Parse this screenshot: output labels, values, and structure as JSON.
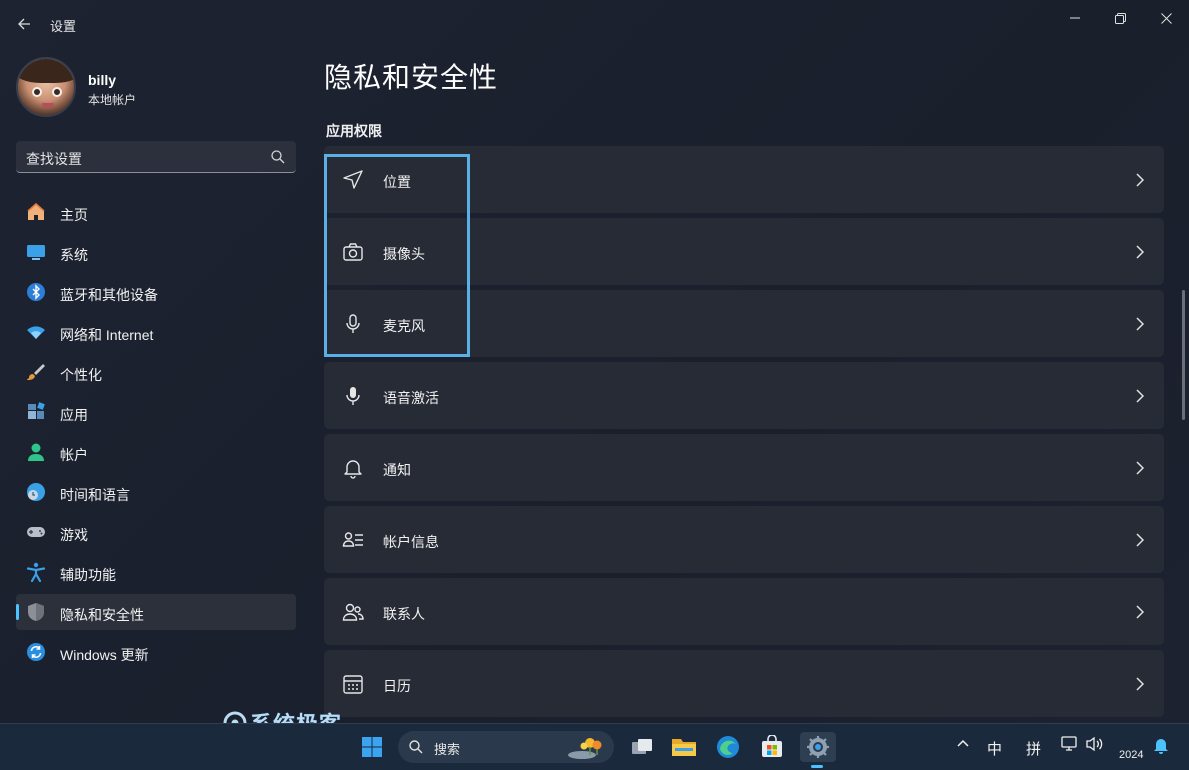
{
  "window": {
    "title": "设置",
    "back_icon": "arrow-left-icon",
    "controls": [
      "minimize-icon",
      "restore-icon",
      "close-icon"
    ]
  },
  "profile": {
    "name": "billy",
    "account_type": "本地帐户"
  },
  "search": {
    "placeholder": "查找设置"
  },
  "sidebar": {
    "items": [
      {
        "label": "主页",
        "icon": "home-icon",
        "active": false
      },
      {
        "label": "系统",
        "icon": "monitor-icon",
        "active": false
      },
      {
        "label": "蓝牙和其他设备",
        "icon": "bluetooth-icon",
        "active": false
      },
      {
        "label": "网络和 Internet",
        "icon": "wifi-icon",
        "active": false
      },
      {
        "label": "个性化",
        "icon": "brush-icon",
        "active": false
      },
      {
        "label": "应用",
        "icon": "apps-icon",
        "active": false
      },
      {
        "label": "帐户",
        "icon": "person-icon",
        "active": false
      },
      {
        "label": "时间和语言",
        "icon": "clock-globe-icon",
        "active": false
      },
      {
        "label": "游戏",
        "icon": "gamepad-icon",
        "active": false
      },
      {
        "label": "辅助功能",
        "icon": "accessibility-icon",
        "active": false
      },
      {
        "label": "隐私和安全性",
        "icon": "shield-icon",
        "active": true
      },
      {
        "label": "Windows 更新",
        "icon": "update-icon",
        "active": false
      }
    ]
  },
  "main": {
    "title": "隐私和安全性",
    "section": "应用权限",
    "rows": [
      {
        "label": "位置",
        "icon": "location-icon"
      },
      {
        "label": "摄像头",
        "icon": "camera-icon"
      },
      {
        "label": "麦克风",
        "icon": "microphone-icon"
      },
      {
        "label": "语音激活",
        "icon": "voice-activation-icon"
      },
      {
        "label": "通知",
        "icon": "bell-icon"
      },
      {
        "label": "帐户信息",
        "icon": "account-info-icon"
      },
      {
        "label": "联系人",
        "icon": "contacts-icon"
      },
      {
        "label": "日历",
        "icon": "calendar-icon"
      }
    ]
  },
  "watermark": {
    "text": "系统极客"
  },
  "taskbar": {
    "search_text": "搜索",
    "apps": [
      "start-icon",
      "task-view-icon",
      "file-explorer-icon",
      "edge-icon",
      "store-icon",
      "settings-icon"
    ],
    "tray": {
      "ime_lang": "中",
      "ime_mode": "拼",
      "year": "2024"
    }
  },
  "colors": {
    "accent": "#4cc2ff",
    "highlight_box": "#5ab0e6",
    "row_bg": "#262b36",
    "window_bg": "#1d2331"
  }
}
